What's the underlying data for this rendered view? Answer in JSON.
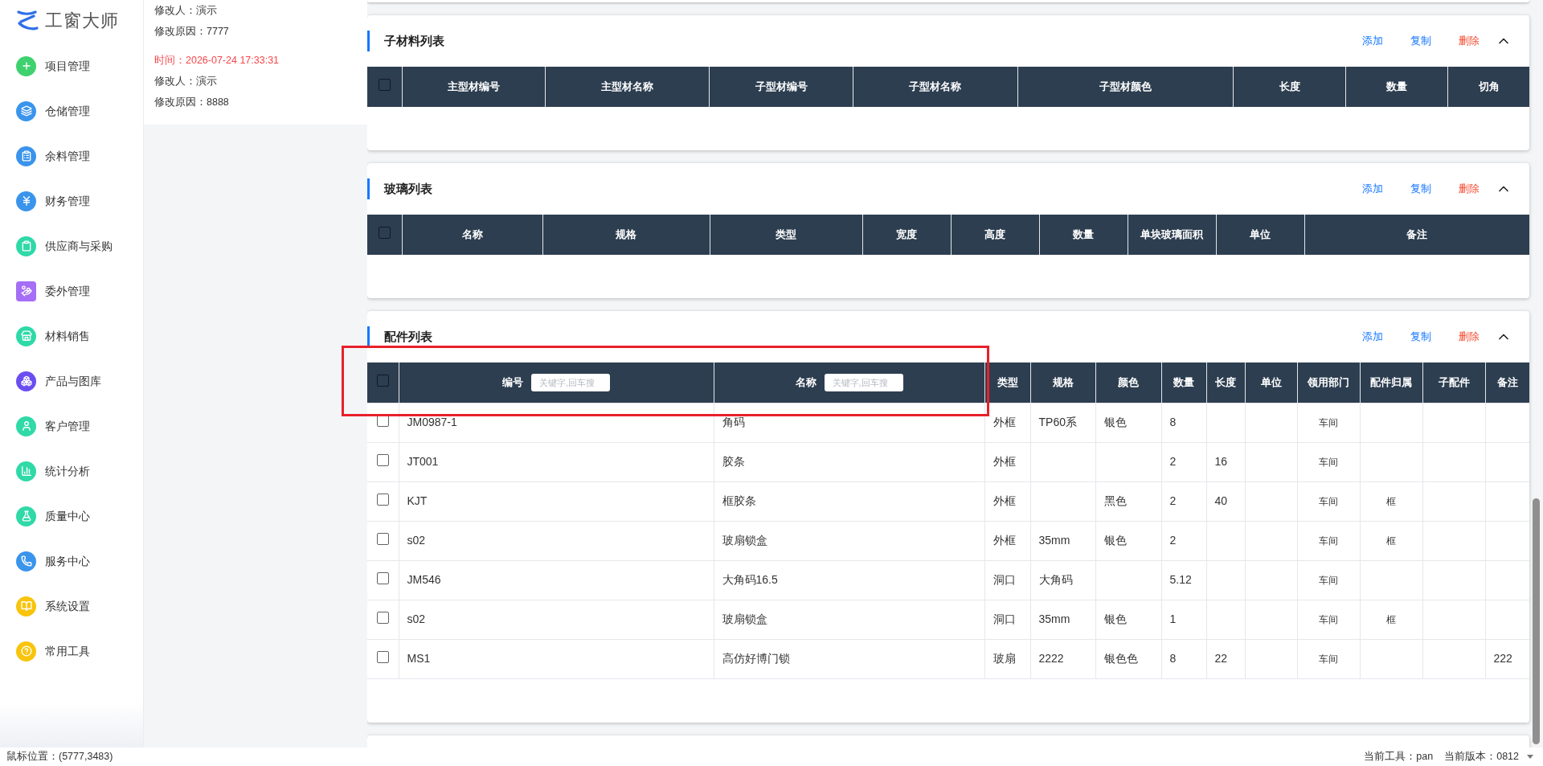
{
  "sidebar": {
    "logo": "工窗大师",
    "items": [
      {
        "label": "项目管理"
      },
      {
        "label": "仓储管理"
      },
      {
        "label": "余料管理"
      },
      {
        "label": "财务管理"
      },
      {
        "label": "供应商与采购"
      },
      {
        "label": "委外管理"
      },
      {
        "label": "材料销售"
      },
      {
        "label": "产品与图库"
      },
      {
        "label": "客户管理"
      },
      {
        "label": "统计分析"
      },
      {
        "label": "质量中心"
      },
      {
        "label": "服务中心"
      },
      {
        "label": "系统设置"
      },
      {
        "label": "常用工具"
      }
    ]
  },
  "log_panel": {
    "entries": [
      {
        "kind": "field",
        "text": "修改人：演示"
      },
      {
        "kind": "field",
        "text": "修改原因：7777"
      },
      {
        "kind": "time",
        "text": "时间：2026-07-24 17:33:31"
      },
      {
        "kind": "field",
        "text": "修改人：演示"
      },
      {
        "kind": "field",
        "text": "修改原因：8888"
      }
    ]
  },
  "sections": [
    {
      "title": "子材料列表",
      "expanded": true,
      "select_all_checked": false,
      "actions": [
        {
          "label": "添加",
          "kind": "primary"
        },
        {
          "label": "复制",
          "kind": "primary"
        },
        {
          "label": "删除",
          "kind": "danger"
        }
      ],
      "columns": [
        {
          "label": "主型材编号"
        },
        {
          "label": "主型材名称"
        },
        {
          "label": "子型材编号"
        },
        {
          "label": "子型材名称"
        },
        {
          "label": "子型材颜色"
        },
        {
          "label": "长度"
        },
        {
          "label": "数量"
        },
        {
          "label": "切角"
        }
      ]
    },
    {
      "title": "玻璃列表",
      "expanded": true,
      "select_all_checked": false,
      "actions": [
        {
          "label": "添加",
          "kind": "primary"
        },
        {
          "label": "复制",
          "kind": "primary"
        },
        {
          "label": "删除",
          "kind": "danger"
        }
      ],
      "columns": [
        {
          "label": "名称"
        },
        {
          "label": "规格"
        },
        {
          "label": "类型"
        },
        {
          "label": "宽度"
        },
        {
          "label": "高度"
        },
        {
          "label": "数量"
        },
        {
          "label": "单块玻璃面积"
        },
        {
          "label": "单位"
        },
        {
          "label": "备注"
        }
      ]
    },
    {
      "title": "配件列表",
      "expanded": true,
      "select_all_checked": false,
      "actions": [
        {
          "label": "添加",
          "kind": "primary"
        },
        {
          "label": "复制",
          "kind": "primary"
        },
        {
          "label": "删除",
          "kind": "danger"
        }
      ],
      "columns": [
        {
          "label": "编号",
          "filter_placeholder": "关键字,回车搜"
        },
        {
          "label": "名称",
          "filter_placeholder": "关键字,回车搜"
        },
        {
          "label": "类型"
        },
        {
          "label": "规格"
        },
        {
          "label": "颜色"
        },
        {
          "label": "数量"
        },
        {
          "label": "长度"
        },
        {
          "label": "单位"
        },
        {
          "label": "领用部门"
        },
        {
          "label": "配件归属"
        },
        {
          "label": "子配件"
        },
        {
          "label": "备注"
        }
      ],
      "rows": [
        {
          "checked": false,
          "cells": [
            "JM0987-1",
            "角码",
            "外框",
            "TP60系",
            "银色",
            "8",
            "",
            "",
            "车间",
            "",
            "",
            ""
          ]
        },
        {
          "checked": false,
          "cells": [
            "JT001",
            "胶条",
            "外框",
            "",
            "",
            "2",
            "16",
            "",
            "车间",
            "",
            "",
            ""
          ]
        },
        {
          "checked": false,
          "cells": [
            "KJT",
            "框胶条",
            "外框",
            "",
            "黑色",
            "2",
            "40",
            "",
            "车间",
            "框",
            "",
            ""
          ]
        },
        {
          "checked": false,
          "cells": [
            "s02",
            "玻扇锁盒",
            "外框",
            "35mm",
            "银色",
            "2",
            "",
            "",
            "车间",
            "框",
            "",
            ""
          ]
        },
        {
          "checked": false,
          "cells": [
            "JM546",
            "大角码16.5",
            "洞口",
            "大角码",
            "",
            "5.12",
            "",
            "",
            "车间",
            "",
            "",
            ""
          ]
        },
        {
          "checked": false,
          "cells": [
            "s02",
            "玻扇锁盒",
            "洞口",
            "35mm",
            "银色",
            "1",
            "",
            "",
            "车间",
            "框",
            "",
            ""
          ]
        },
        {
          "checked": false,
          "cells": [
            "MS1",
            "高仿好博门锁",
            "玻扇",
            "2222",
            "银色色",
            "8",
            "22",
            "",
            "车间",
            "",
            "",
            "222"
          ]
        }
      ]
    }
  ],
  "status_bar": {
    "mouse_position": "鼠标位置：(5777,3483)",
    "tool": "当前工具：pan",
    "version": "当前版本：0812"
  }
}
